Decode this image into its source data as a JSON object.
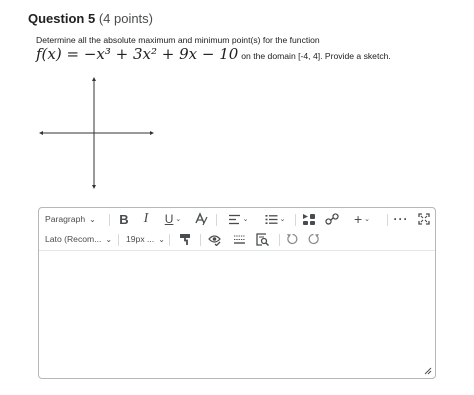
{
  "question": {
    "title": "Question 5",
    "points": "(4 points)"
  },
  "prompt": {
    "line1": "Determine all the absolute maximum and minimum point(s) for the function",
    "equation": "f(x) = −x³ + 3x² + 9x − 10",
    "line2": "on the domain [-4, 4]. Provide a sketch."
  },
  "editor": {
    "block_format": "Paragraph",
    "font_family": "Lato (Recom...",
    "font_size": "19px ...",
    "content": ""
  },
  "icons": {
    "bold": "bold-icon",
    "italic": "italic-icon",
    "underline": "underline-icon",
    "text_color": "text-color-icon",
    "align": "align-icon",
    "list": "bullet-list-icon",
    "insert_media": "insert-media-icon",
    "link": "link-icon",
    "add": "plus-icon",
    "more": "more-icon",
    "fullscreen": "fullscreen-icon",
    "format_painter": "format-painter-icon",
    "accessibility": "accessibility-check-icon",
    "word_count": "word-count-icon",
    "preview": "preview-icon",
    "undo": "undo-icon",
    "redo": "redo-icon",
    "resize": "resize-grip-icon"
  },
  "colors": {
    "text": "#202122",
    "icon": "#494c4e",
    "border": "#b5b7ba"
  }
}
